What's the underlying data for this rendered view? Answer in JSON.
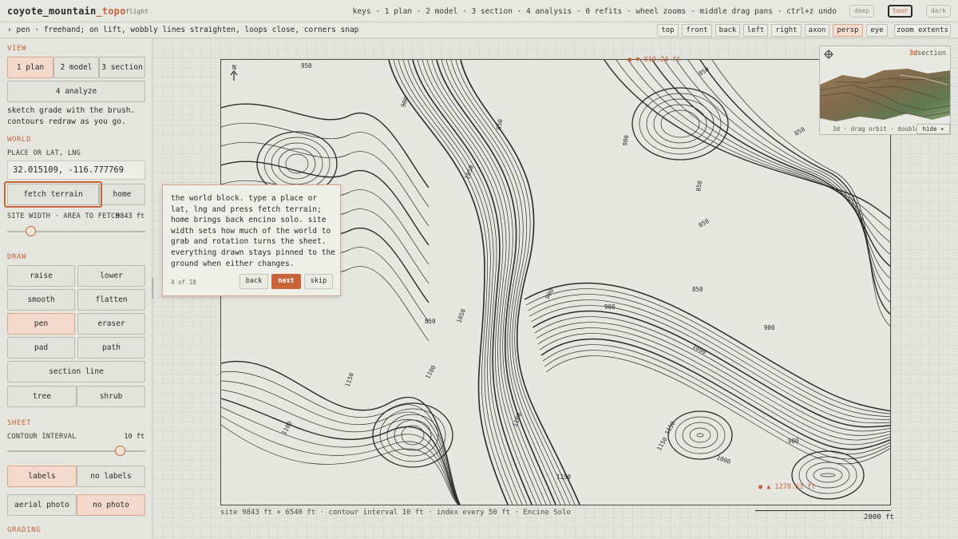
{
  "app": {
    "name": "coyote_mountain",
    "name_accent": "_topo",
    "tag": "flight"
  },
  "keys_hint": "keys · 1 plan · 2 model · 3 section · 4 analysis · 0 refits · wheel zooms · middle drag pans · ctrl+z undo",
  "modes": [
    "deep",
    "tour",
    "dark"
  ],
  "active_mode": "tour",
  "tool_hint": "› pen · freehand; on lift, wobbly lines straighten, loops close, corners snap",
  "view_buttons": [
    "top",
    "front",
    "back",
    "left",
    "right",
    "axon",
    "persp",
    "eye",
    "zoom extents"
  ],
  "active_view": "persp",
  "sidebar": {
    "view": {
      "title": "VIEW",
      "tabs": [
        "1 plan",
        "2 model",
        "3 section"
      ],
      "analyze": "4 analyze",
      "description": "sketch grade with the brush. contours redraw as you go."
    },
    "world": {
      "title": "WORLD",
      "place_label": "PLACE OR LAT, LNG",
      "place_value": "32.015109, -116.777769",
      "fetch": "fetch terrain",
      "home": "home",
      "site_width_label": "SITE WIDTH · AREA TO FETCH",
      "site_width_value": "9843 ft",
      "site_width_fraction": 0.17
    },
    "draw": {
      "title": "DRAW",
      "tools": [
        "raise",
        "lower",
        "smooth",
        "flatten",
        "pen",
        "eraser",
        "pad",
        "path"
      ],
      "active_tool": "pen",
      "section_line": "section line",
      "tree": "tree",
      "shrub": "shrub"
    },
    "sheet": {
      "title": "SHEET",
      "interval_label": "CONTOUR INTERVAL",
      "interval_value": "10 ft",
      "interval_fraction": 0.82,
      "labels": "labels",
      "no_labels": "no labels",
      "aerial": "aerial photo",
      "no_photo": "no photo"
    },
    "grading": {
      "title": "GRADING"
    }
  },
  "map": {
    "north": "N",
    "elev_high": "● ▼ 810.24 ft",
    "elev_low": "● ▲ 1278.63 ft",
    "footer": "site 9843 ft × 6540 ft · contour interval 10 ft · index every 50 ft · Encino Solo",
    "scale": "2000 ft",
    "contour_labels": [
      "950",
      "850",
      "850",
      "850",
      "900",
      "850",
      "850",
      "900",
      "1050",
      "900",
      "850",
      "850",
      "1050",
      "900",
      "900",
      "1000",
      "1100",
      "1150",
      "1100",
      "1150",
      "1100",
      "1150",
      "900",
      "1150",
      "1000"
    ]
  },
  "inset": {
    "label_a": "3d",
    "label_b": "section",
    "footer": "3d · drag orbit · double-",
    "hide": "hide ▾"
  },
  "tour": {
    "text": "the world block. type a place or lat, lng and press fetch terrain; home brings back encino solo. site width sets how much of the world to grab and rotation turns the sheet. everything drawn stays pinned to the ground when either changes.",
    "count": "4 of 18",
    "back": "back",
    "next": "next",
    "skip": "skip"
  }
}
